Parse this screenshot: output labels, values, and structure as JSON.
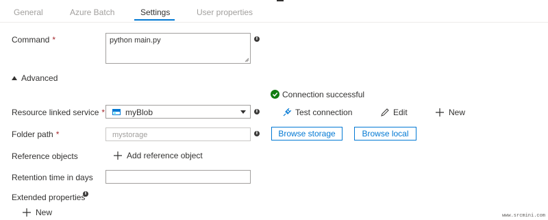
{
  "tabs": [
    "General",
    "Azure Batch",
    "Settings",
    "User properties"
  ],
  "command": {
    "label": "Command",
    "required_mark": "*",
    "value": "python main.py"
  },
  "advanced": {
    "label": "Advanced"
  },
  "status": {
    "text": "Connection successful"
  },
  "linked_service": {
    "label": "Resource linked service",
    "required_mark": "*",
    "value": "myBlob",
    "test_label": "Test connection",
    "edit_label": "Edit",
    "new_label": "New"
  },
  "folder_path": {
    "label": "Folder path",
    "required_mark": "*",
    "value": "mystorage",
    "browse_storage": "Browse storage",
    "browse_local": "Browse local"
  },
  "reference_objects": {
    "label": "Reference objects",
    "add_label": "Add reference object"
  },
  "retention": {
    "label": "Retention time in days",
    "value": ""
  },
  "extended_properties": {
    "label": "Extended properties",
    "new_label": "New"
  },
  "watermark": "www.srcmini.com",
  "colors": {
    "accent": "#0078d4",
    "success": "#107c10",
    "required": "#a4262c"
  }
}
